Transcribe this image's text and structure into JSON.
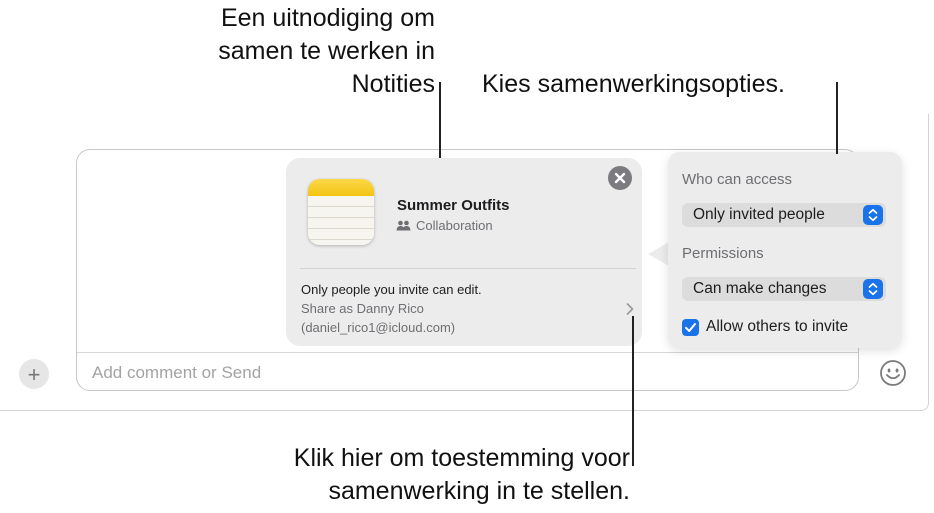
{
  "callouts": {
    "invite": "Een uitnodiging om samen te werken in Notities",
    "options": "Kies samenwerkingsopties.",
    "permissions": "Klik hier om toestemming voor samenwerking in te stellen."
  },
  "card": {
    "title": "Summer Outfits",
    "subtitle": "Collaboration",
    "icon": "notes-app-icon",
    "close_icon": "close-icon",
    "share_line1": "Only people you invite can edit.",
    "share_line2": "Share as Danny Rico",
    "share_line3": "(daniel_rico1@icloud.com)"
  },
  "options_panel": {
    "access_heading": "Who can access",
    "access_value": "Only invited people",
    "permissions_heading": "Permissions",
    "permissions_value": "Can make changes",
    "allow_invite_label": "Allow others to invite",
    "allow_invite_checked": true
  },
  "composer": {
    "placeholder": "Add comment or Send"
  },
  "icons": {
    "plus": "plus-icon",
    "emoji": "emoji-icon",
    "people": "people-icon",
    "chevron": "chevron-right-icon"
  },
  "colors": {
    "accent": "#1a73e8",
    "panel_bg": "#ececec"
  }
}
